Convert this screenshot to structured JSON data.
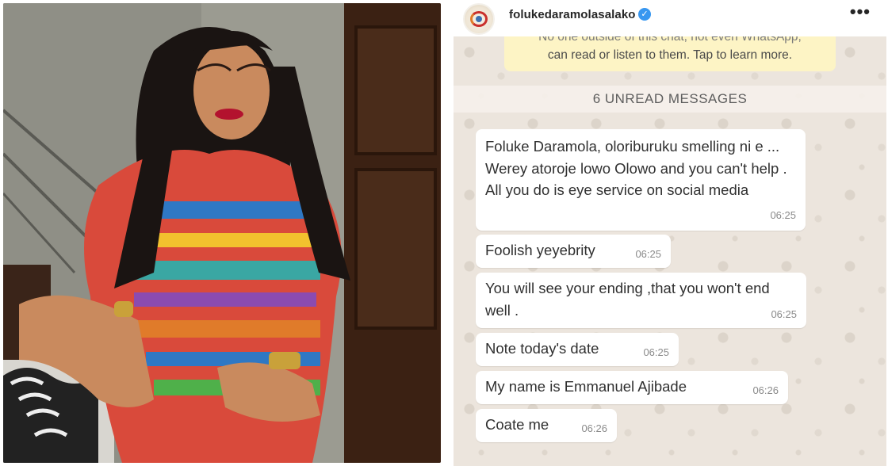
{
  "photo": {
    "description_icon": "person-photo"
  },
  "header": {
    "username": "folukedaramolasalako",
    "verified_glyph": "✓",
    "more_glyph": "•••"
  },
  "chat": {
    "encryption_top": "No one outside of this chat, not even WhatsApp,",
    "encryption_bottom": "can read or listen to them. Tap to learn more.",
    "unread_label": "6 UNREAD MESSAGES",
    "messages": [
      {
        "text": "Foluke Daramola, oloriburuku smelling ni e ... Werey atoroje lowo Olowo and you can't help . All you do is eye service on social media",
        "time": "06:25"
      },
      {
        "text": "Foolish yeyebrity",
        "time": "06:25"
      },
      {
        "text": "You will see your ending ,that you won't end well .",
        "time": "06:25"
      },
      {
        "text": "Note today's date",
        "time": "06:25"
      },
      {
        "text": "My name is Emmanuel Ajibade",
        "time": "06:26"
      },
      {
        "text": "Coate me",
        "time": "06:26"
      }
    ]
  },
  "colors": {
    "chat_bg": "#ece5dd",
    "bubble_bg": "#ffffff",
    "encryption_bg": "#fdf4c5",
    "verified": "#3897f0"
  }
}
